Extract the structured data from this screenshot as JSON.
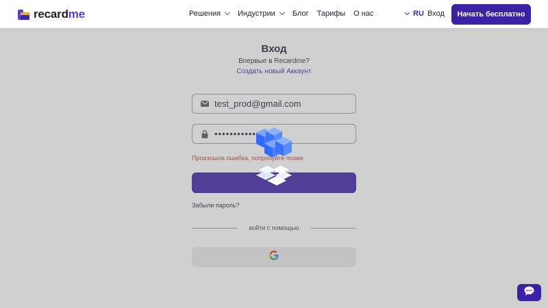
{
  "header": {
    "logo_main": "recard",
    "logo_accent": "me",
    "nav": [
      {
        "label": "Решения",
        "has_dropdown": true
      },
      {
        "label": "Индустрии",
        "has_dropdown": true
      },
      {
        "label": "Блог",
        "has_dropdown": false
      },
      {
        "label": "Тарифы",
        "has_dropdown": false
      },
      {
        "label": "О нас",
        "has_dropdown": false
      }
    ],
    "language": "RU",
    "login_label": "Вход",
    "cta_label": "Начать бесплатно"
  },
  "form": {
    "title": "Вход",
    "subtitle": "Впервые в Recardme?",
    "create_account_link": "Создать новый Аккаунт",
    "email_value": "test_prod@gmail.com",
    "password_value": "•••••••••••",
    "error_message": "Произошла ошибка, попробуйте позже.",
    "forgot_password": "Забыли пароль?",
    "divider_text": "войти с помощью"
  },
  "colors": {
    "brand": "#3a22a5",
    "brand_light": "#5b3fd8",
    "error": "#c23b3b",
    "overlay": "rgba(120,120,120,0.35)"
  },
  "icons": {
    "email": "mail-icon",
    "password": "lock-icon",
    "social": "google-icon",
    "loader": "loading-cubes-icon",
    "chat": "chat-bubble-icon"
  }
}
